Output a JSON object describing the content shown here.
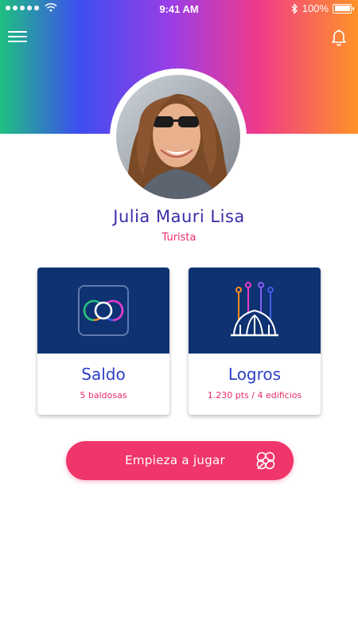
{
  "status_bar": {
    "carrier_label": "",
    "time": "9:41 AM",
    "battery": "100%"
  },
  "header": {
    "menu_icon": "hamburger-menu-icon",
    "notifications_icon": "bell-icon"
  },
  "profile": {
    "name": "Julia Mauri Lisa",
    "role": "Turista",
    "avatar_icon": "profile-photo"
  },
  "cards": [
    {
      "title": "Saldo",
      "subtitle": "5 baldosas",
      "icon": "tile-flower-icon"
    },
    {
      "title": "Logros",
      "subtitle": "1.230 pts / 4 edificios",
      "icon": "sagrada-familia-icon"
    }
  ],
  "cta": {
    "label": "Empieza a jugar",
    "icon": "tile-pattern-icon"
  },
  "colors": {
    "accent": "#f0356a",
    "navy": "#0e3272",
    "name": "#3b2fa8"
  }
}
